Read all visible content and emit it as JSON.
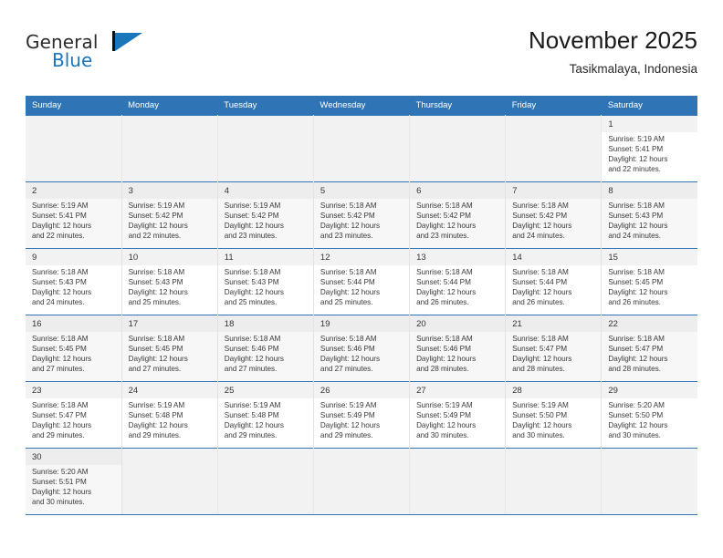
{
  "brand": {
    "word_one": "General",
    "word_two": "Blue",
    "flag_icon": "flag-triangle-icon",
    "accent_color": "#1b75bb"
  },
  "header": {
    "title": "November 2025",
    "subtitle": "Tasikmalaya, Indonesia"
  },
  "colors": {
    "header_row": "#2f75b5",
    "daynum_bg": "#f2f2f2",
    "grid_line": "#2f75b5",
    "text": "#3a3a3a"
  },
  "calendar": {
    "weekday_headers": [
      "Sunday",
      "Monday",
      "Tuesday",
      "Wednesday",
      "Thursday",
      "Friday",
      "Saturday"
    ],
    "weeks": [
      [
        {
          "empty": true
        },
        {
          "empty": true
        },
        {
          "empty": true
        },
        {
          "empty": true
        },
        {
          "empty": true
        },
        {
          "empty": true
        },
        {
          "day": "1",
          "l1": "Sunrise: 5:19 AM",
          "l2": "Sunset: 5:41 PM",
          "l3": "Daylight: 12 hours",
          "l4": "and 22 minutes."
        }
      ],
      [
        {
          "day": "2",
          "l1": "Sunrise: 5:19 AM",
          "l2": "Sunset: 5:41 PM",
          "l3": "Daylight: 12 hours",
          "l4": "and 22 minutes."
        },
        {
          "day": "3",
          "l1": "Sunrise: 5:19 AM",
          "l2": "Sunset: 5:42 PM",
          "l3": "Daylight: 12 hours",
          "l4": "and 22 minutes."
        },
        {
          "day": "4",
          "l1": "Sunrise: 5:19 AM",
          "l2": "Sunset: 5:42 PM",
          "l3": "Daylight: 12 hours",
          "l4": "and 23 minutes."
        },
        {
          "day": "5",
          "l1": "Sunrise: 5:18 AM",
          "l2": "Sunset: 5:42 PM",
          "l3": "Daylight: 12 hours",
          "l4": "and 23 minutes."
        },
        {
          "day": "6",
          "l1": "Sunrise: 5:18 AM",
          "l2": "Sunset: 5:42 PM",
          "l3": "Daylight: 12 hours",
          "l4": "and 23 minutes."
        },
        {
          "day": "7",
          "l1": "Sunrise: 5:18 AM",
          "l2": "Sunset: 5:42 PM",
          "l3": "Daylight: 12 hours",
          "l4": "and 24 minutes."
        },
        {
          "day": "8",
          "l1": "Sunrise: 5:18 AM",
          "l2": "Sunset: 5:43 PM",
          "l3": "Daylight: 12 hours",
          "l4": "and 24 minutes."
        }
      ],
      [
        {
          "day": "9",
          "l1": "Sunrise: 5:18 AM",
          "l2": "Sunset: 5:43 PM",
          "l3": "Daylight: 12 hours",
          "l4": "and 24 minutes."
        },
        {
          "day": "10",
          "l1": "Sunrise: 5:18 AM",
          "l2": "Sunset: 5:43 PM",
          "l3": "Daylight: 12 hours",
          "l4": "and 25 minutes."
        },
        {
          "day": "11",
          "l1": "Sunrise: 5:18 AM",
          "l2": "Sunset: 5:43 PM",
          "l3": "Daylight: 12 hours",
          "l4": "and 25 minutes."
        },
        {
          "day": "12",
          "l1": "Sunrise: 5:18 AM",
          "l2": "Sunset: 5:44 PM",
          "l3": "Daylight: 12 hours",
          "l4": "and 25 minutes."
        },
        {
          "day": "13",
          "l1": "Sunrise: 5:18 AM",
          "l2": "Sunset: 5:44 PM",
          "l3": "Daylight: 12 hours",
          "l4": "and 26 minutes."
        },
        {
          "day": "14",
          "l1": "Sunrise: 5:18 AM",
          "l2": "Sunset: 5:44 PM",
          "l3": "Daylight: 12 hours",
          "l4": "and 26 minutes."
        },
        {
          "day": "15",
          "l1": "Sunrise: 5:18 AM",
          "l2": "Sunset: 5:45 PM",
          "l3": "Daylight: 12 hours",
          "l4": "and 26 minutes."
        }
      ],
      [
        {
          "day": "16",
          "l1": "Sunrise: 5:18 AM",
          "l2": "Sunset: 5:45 PM",
          "l3": "Daylight: 12 hours",
          "l4": "and 27 minutes."
        },
        {
          "day": "17",
          "l1": "Sunrise: 5:18 AM",
          "l2": "Sunset: 5:45 PM",
          "l3": "Daylight: 12 hours",
          "l4": "and 27 minutes."
        },
        {
          "day": "18",
          "l1": "Sunrise: 5:18 AM",
          "l2": "Sunset: 5:46 PM",
          "l3": "Daylight: 12 hours",
          "l4": "and 27 minutes."
        },
        {
          "day": "19",
          "l1": "Sunrise: 5:18 AM",
          "l2": "Sunset: 5:46 PM",
          "l3": "Daylight: 12 hours",
          "l4": "and 27 minutes."
        },
        {
          "day": "20",
          "l1": "Sunrise: 5:18 AM",
          "l2": "Sunset: 5:46 PM",
          "l3": "Daylight: 12 hours",
          "l4": "and 28 minutes."
        },
        {
          "day": "21",
          "l1": "Sunrise: 5:18 AM",
          "l2": "Sunset: 5:47 PM",
          "l3": "Daylight: 12 hours",
          "l4": "and 28 minutes."
        },
        {
          "day": "22",
          "l1": "Sunrise: 5:18 AM",
          "l2": "Sunset: 5:47 PM",
          "l3": "Daylight: 12 hours",
          "l4": "and 28 minutes."
        }
      ],
      [
        {
          "day": "23",
          "l1": "Sunrise: 5:18 AM",
          "l2": "Sunset: 5:47 PM",
          "l3": "Daylight: 12 hours",
          "l4": "and 29 minutes."
        },
        {
          "day": "24",
          "l1": "Sunrise: 5:19 AM",
          "l2": "Sunset: 5:48 PM",
          "l3": "Daylight: 12 hours",
          "l4": "and 29 minutes."
        },
        {
          "day": "25",
          "l1": "Sunrise: 5:19 AM",
          "l2": "Sunset: 5:48 PM",
          "l3": "Daylight: 12 hours",
          "l4": "and 29 minutes."
        },
        {
          "day": "26",
          "l1": "Sunrise: 5:19 AM",
          "l2": "Sunset: 5:49 PM",
          "l3": "Daylight: 12 hours",
          "l4": "and 29 minutes."
        },
        {
          "day": "27",
          "l1": "Sunrise: 5:19 AM",
          "l2": "Sunset: 5:49 PM",
          "l3": "Daylight: 12 hours",
          "l4": "and 30 minutes."
        },
        {
          "day": "28",
          "l1": "Sunrise: 5:19 AM",
          "l2": "Sunset: 5:50 PM",
          "l3": "Daylight: 12 hours",
          "l4": "and 30 minutes."
        },
        {
          "day": "29",
          "l1": "Sunrise: 5:20 AM",
          "l2": "Sunset: 5:50 PM",
          "l3": "Daylight: 12 hours",
          "l4": "and 30 minutes."
        }
      ],
      [
        {
          "day": "30",
          "l1": "Sunrise: 5:20 AM",
          "l2": "Sunset: 5:51 PM",
          "l3": "Daylight: 12 hours",
          "l4": "and 30 minutes."
        },
        {
          "empty": true
        },
        {
          "empty": true
        },
        {
          "empty": true
        },
        {
          "empty": true
        },
        {
          "empty": true
        },
        {
          "empty": true
        }
      ]
    ]
  }
}
